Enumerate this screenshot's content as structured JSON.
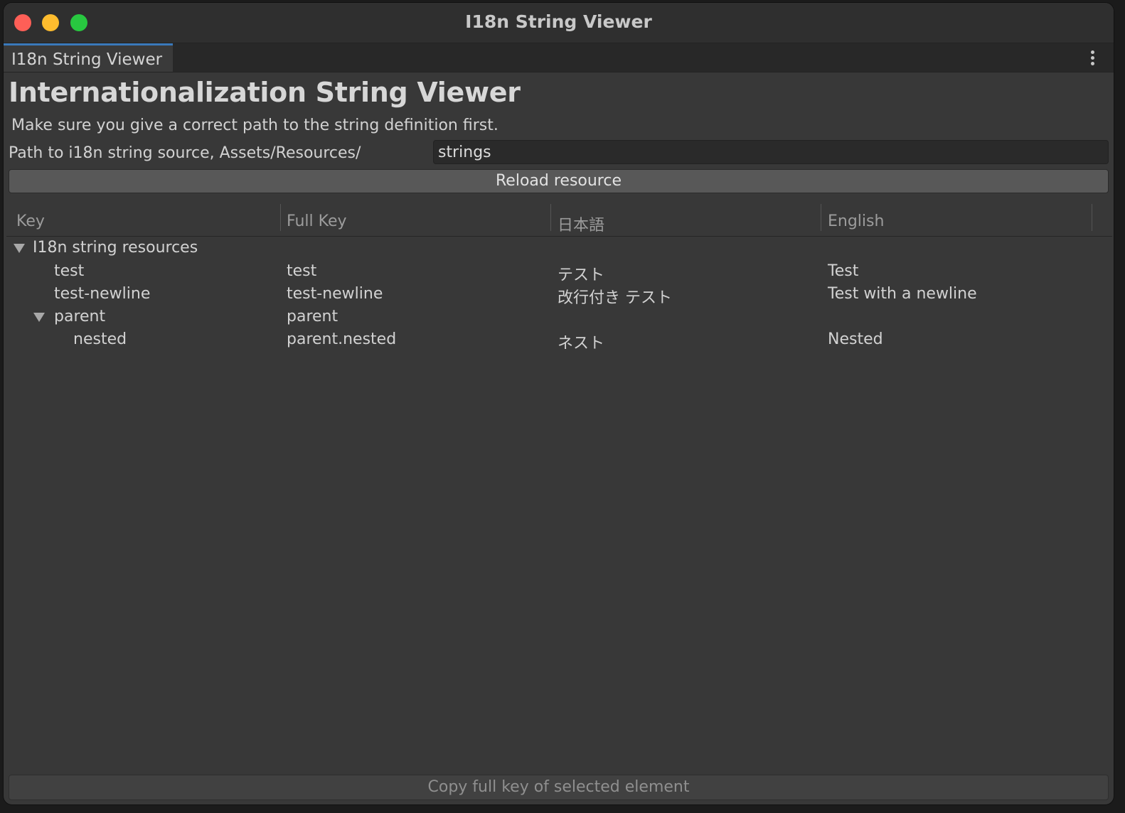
{
  "window": {
    "title": "I18n String Viewer"
  },
  "tab": {
    "label": "I18n String Viewer"
  },
  "heading": "Internationalization String Viewer",
  "hint": "Make sure you give a correct path to the string definition first.",
  "path": {
    "label": "Path to i18n string source, Assets/Resources/",
    "value": "strings"
  },
  "reload_label": "Reload resource",
  "columns": [
    "Key",
    "Full Key",
    "日本語",
    "English"
  ],
  "rows": [
    {
      "key": "I18n string resources",
      "full_key": "",
      "ja": "",
      "en": "",
      "depth": 0,
      "expanded": true
    },
    {
      "key": "test",
      "full_key": "test",
      "ja": "テスト",
      "en": "Test",
      "depth": 1
    },
    {
      "key": "test-newline",
      "full_key": "test-newline",
      "ja": "改行付き テスト",
      "en": "Test with a newline",
      "depth": 1
    },
    {
      "key": "parent",
      "full_key": "parent",
      "ja": "",
      "en": "",
      "depth": 1,
      "expanded": true
    },
    {
      "key": "nested",
      "full_key": "parent.nested",
      "ja": "ネスト",
      "en": "Nested",
      "depth": 2
    }
  ],
  "copy_label": "Copy full key of selected element",
  "icons": {
    "close": "close-dot",
    "minimize": "minimize-dot",
    "maximize": "maximize-dot",
    "menu": "kebab-menu-icon",
    "expand": "triangle-down-icon"
  }
}
